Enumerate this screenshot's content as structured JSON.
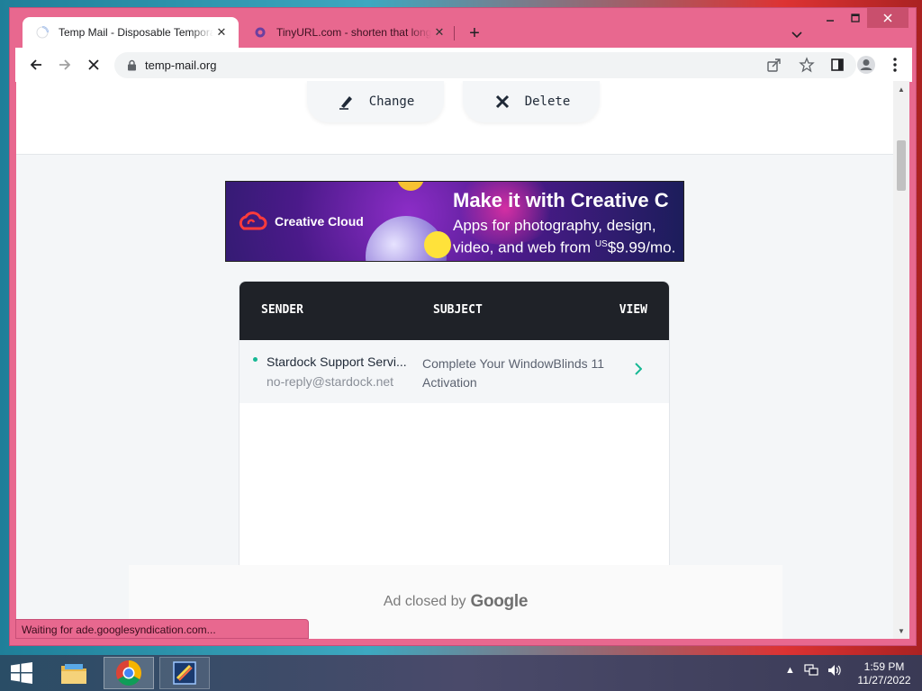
{
  "browser": {
    "tabs": [
      {
        "title": "Temp Mail - Disposable Temporary Email",
        "active": true
      },
      {
        "title": "TinyURL.com - shorten that long URL",
        "active": false
      }
    ],
    "address": "temp-mail.org",
    "status_text": "Waiting for ade.googlesyndication.com..."
  },
  "actions": {
    "change_label": "Change",
    "delete_label": "Delete"
  },
  "ad": {
    "brand": "Creative Cloud",
    "headline": "Make it with Creative C",
    "subline_1": "Apps for photography, design,",
    "subline_2_pre": "video, and web from ",
    "subline_2_currency": "US",
    "subline_2_price": "$9.99/mo."
  },
  "inbox": {
    "columns": {
      "sender": "SENDER",
      "subject": "SUBJECT",
      "view": "VIEW"
    },
    "messages": [
      {
        "sender_name": "Stardock Support Servi...",
        "sender_email": "no-reply@stardock.net",
        "subject": "Complete Your WindowBlinds 11 Activation",
        "unread": true
      }
    ]
  },
  "ad_closed": {
    "text": "Ad closed by",
    "brand": "Google"
  },
  "taskbar": {
    "time": "1:59 PM",
    "date": "11/27/2022"
  },
  "colors": {
    "window_frame": "#e8688f",
    "inbox_header": "#1f2228",
    "accent_green": "#16b894"
  },
  "icons": {
    "tab1_favicon": "loading-spinner-icon",
    "tab2_favicon": "tinyurl-icon",
    "back": "arrow-left-icon",
    "forward": "arrow-right-icon",
    "stop": "close-icon",
    "lock": "lock-icon",
    "share": "share-icon",
    "bookmark": "star-icon",
    "sidepanel": "side-panel-icon",
    "profile": "profile-icon",
    "menu": "kebab-menu-icon",
    "change": "pen-icon",
    "delete": "x-icon",
    "view": "chevron-right-icon"
  }
}
